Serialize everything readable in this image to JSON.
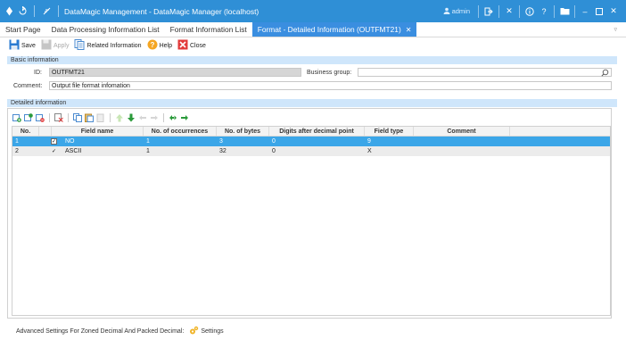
{
  "window": {
    "title": "DataMagic Management - DataMagic Manager (localhost)",
    "user": "admin",
    "accent": "#2f8fd6"
  },
  "tabs": [
    {
      "label": "Start Page"
    },
    {
      "label": "Data Processing Information List"
    },
    {
      "label": "Format Information List"
    },
    {
      "label": "Format - Detailed Information (OUTFMT21)"
    }
  ],
  "toolbar": {
    "save": "Save",
    "apply": "Apply",
    "related": "Related Information",
    "help": "Help",
    "close": "Close"
  },
  "basic": {
    "section": "Basic information",
    "id_label": "ID:",
    "id_value": "OUTFMT21",
    "business_group_label": "Business group:",
    "business_group_value": "",
    "comment_label": "Comment:",
    "comment_value": "Output file format infomation"
  },
  "detail": {
    "section": "Detailed information",
    "columns": [
      "No.",
      "Field name",
      "No. of occurrences",
      "No. of bytes",
      "Digits after decimal point",
      "Field type",
      "Comment"
    ],
    "rows": [
      {
        "no": "1",
        "checked": true,
        "field_name": "NO",
        "occurrences": "1",
        "bytes": "3",
        "digits": "0",
        "field_type": "9",
        "comment": ""
      },
      {
        "no": "2",
        "checked": true,
        "field_name": "ASCII",
        "occurrences": "1",
        "bytes": "32",
        "digits": "0",
        "field_type": "X",
        "comment": ""
      }
    ]
  },
  "footer": {
    "label": "Advanced Settings For Zoned Decimal And Packed Decimal:",
    "settings": "Settings"
  }
}
